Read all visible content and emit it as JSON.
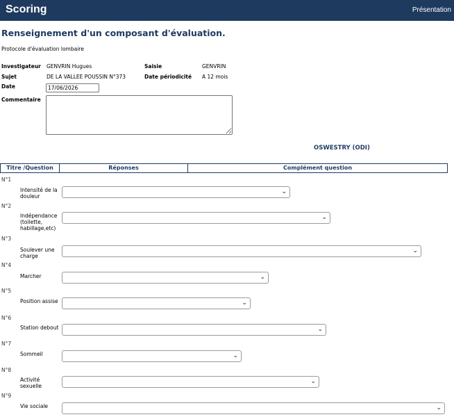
{
  "header": {
    "app_title": "Scoring",
    "nav_link": "Présentation"
  },
  "page": {
    "heading": "Renseignement d'un composant d'évaluation.",
    "protocol": "Protocole d'évaluation lombaire"
  },
  "info": {
    "investigateur_label": "Investigateur",
    "investigateur_value": "GENVRIN Hugues",
    "saisie_label": "Saisie",
    "saisie_value": "GENVRIN",
    "sujet_label": "Sujet",
    "sujet_value": "DE LA VALLEE POUSSIN N°373",
    "date_periodicite_label": "Date périodicité",
    "date_periodicite_value": "A 12 mois",
    "date_label": "Date",
    "date_value": "17/06/2026",
    "commentaire_label": "Commentaire",
    "commentaire_value": ""
  },
  "scale_title": "OSWESTRY (ODI)",
  "table": {
    "col_titre": "Titre /Question",
    "col_reponses": "Réponses",
    "col_complement": "Complément question"
  },
  "questions": [
    {
      "num": "N°1",
      "label": "Intensité de la douleur",
      "selected": ""
    },
    {
      "num": "N°2",
      "label": "Indépendance (toilette, habillage,etc)",
      "selected": ""
    },
    {
      "num": "N°3",
      "label": "Soulever une charge",
      "selected": ""
    },
    {
      "num": "N°4",
      "label": "Marcher",
      "selected": ""
    },
    {
      "num": "N°5",
      "label": "Position assise",
      "selected": ""
    },
    {
      "num": "N°6",
      "label": "Station debout",
      "selected": ""
    },
    {
      "num": "N°7",
      "label": "Sommeil",
      "selected": ""
    },
    {
      "num": "N°8",
      "label": "Activité sexuelle",
      "selected": ""
    },
    {
      "num": "N°9",
      "label": "Vie sociale",
      "selected": ""
    }
  ],
  "icons": {
    "select_arrow": "chevron-down-icon"
  },
  "colors": {
    "header_bg": "#1e3a5f",
    "accent": "#1e3a5f"
  }
}
